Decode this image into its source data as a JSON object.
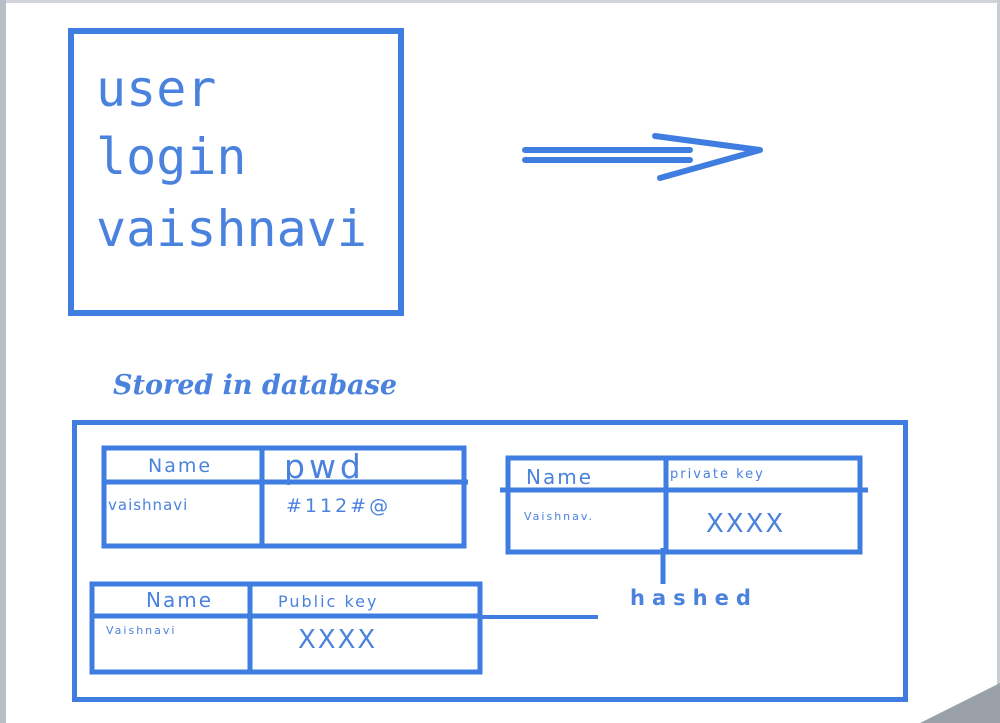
{
  "colors": {
    "stroke": "#3f7de0",
    "frame": "#b9bec6"
  },
  "login_box": {
    "lines": [
      "user",
      "login",
      "vaishnavi"
    ]
  },
  "arrow": {
    "icon": "double-arrow-right-icon"
  },
  "caption": "Stored in database",
  "table_pwd": {
    "headers": [
      "Name",
      "pwd"
    ],
    "row": [
      "vaishnavi",
      "#112#@"
    ]
  },
  "table_private": {
    "headers": [
      "Name",
      "private key"
    ],
    "row": [
      "Vaishnav.",
      "XXXX"
    ]
  },
  "table_public": {
    "headers": [
      "Name",
      "Public key"
    ],
    "row": [
      "Vaishnavi",
      "XXXX"
    ]
  },
  "hashed_label": "hashed"
}
